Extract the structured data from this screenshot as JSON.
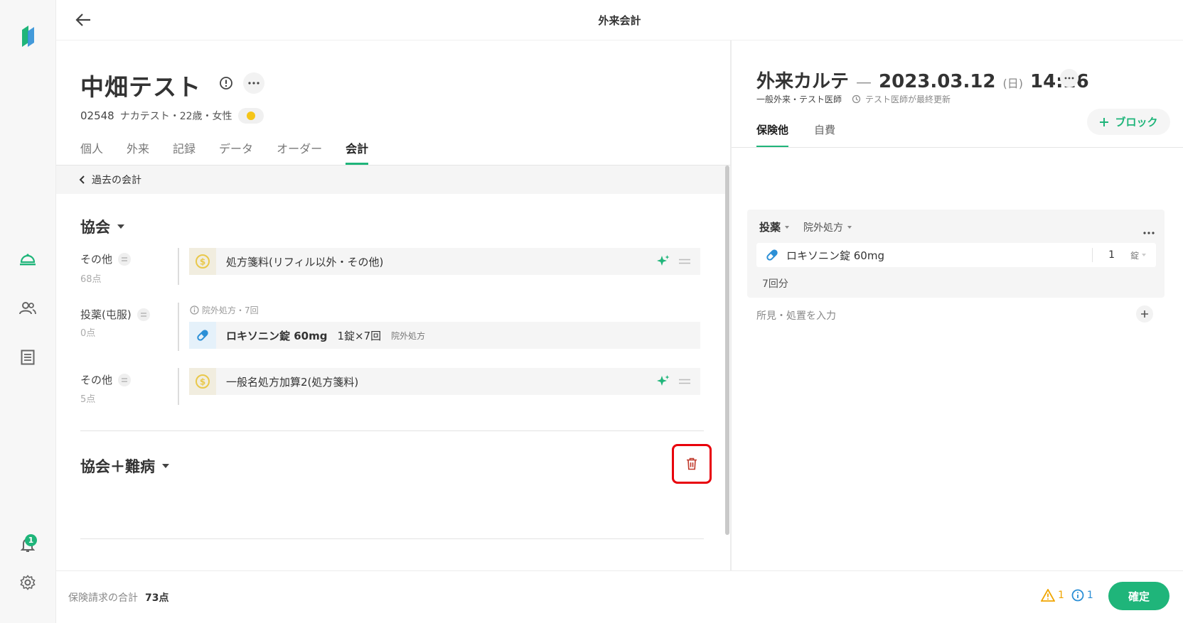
{
  "header": {
    "title": "外来会計"
  },
  "patient": {
    "name": "中畑テスト",
    "id": "02548",
    "details": "ナカテスト・22歳・女性"
  },
  "tabs": [
    "個人",
    "外来",
    "記録",
    "データ",
    "オーダー",
    "会計"
  ],
  "active_tab": "会計",
  "past_billing_label": "過去の会計",
  "groups": [
    {
      "title": "協会",
      "rows": [
        {
          "label": "その他",
          "points": "68点",
          "item": "処方箋料(リフィル以外・その他)"
        },
        {
          "label": "投薬(屯服)",
          "points": "0点",
          "note": "院外処方・7回",
          "item": "ロキソニン錠 60mg",
          "dose": "1錠×7回",
          "tag": "院外処方"
        },
        {
          "label": "その他",
          "points": "5点",
          "item": "一般名処方加算2(処方箋料)"
        }
      ]
    },
    {
      "title": "協会＋難病"
    }
  ],
  "karte": {
    "title": "外来カルテ",
    "date": "2023.03.12",
    "weekday": "(日)",
    "time": "14:26",
    "meta_type": "一般外来・テスト医師",
    "meta_updated": "テスト医師が最終更新",
    "add_block_label": "ブロック",
    "tabs": [
      "保険他",
      "自費"
    ],
    "rx": {
      "category": "投薬",
      "subtype": "院外処方",
      "drug": "ロキソニン錠 60mg",
      "qty": "1",
      "unit": "錠",
      "days": "7回分"
    },
    "findings_placeholder": "所見・処置を入力"
  },
  "footer": {
    "total_label": "保険請求の合計",
    "total_value": "73点",
    "warning_count": "1",
    "info_count": "1",
    "confirm_label": "確定"
  },
  "notification_count": "1",
  "colors": {
    "accent": "#1fb57a",
    "highlight_border": "#e8000b",
    "coin": "#e9c84a",
    "pill": "#2b8fd6"
  }
}
